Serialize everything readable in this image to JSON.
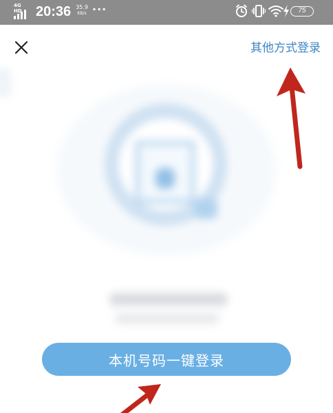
{
  "status_bar": {
    "network": "4G HD",
    "time": "20:36",
    "speed_value": "35.9",
    "speed_unit": "KB/s",
    "more": "···",
    "battery": "75",
    "icons": [
      "signal-icon",
      "alarm-icon",
      "vibrate-icon",
      "wifi-icon",
      "charging-icon",
      "battery-icon"
    ]
  },
  "header": {
    "close_icon": "close-icon",
    "other_login_label": "其他方式登录"
  },
  "main": {
    "login_button_label": "本机号码一键登录"
  },
  "annotations": {
    "arrow_color": "#c0261c"
  },
  "colors": {
    "accent": "#6aafe3",
    "link": "#3f86c4",
    "status_bar_bg": "#8c8c8c"
  }
}
